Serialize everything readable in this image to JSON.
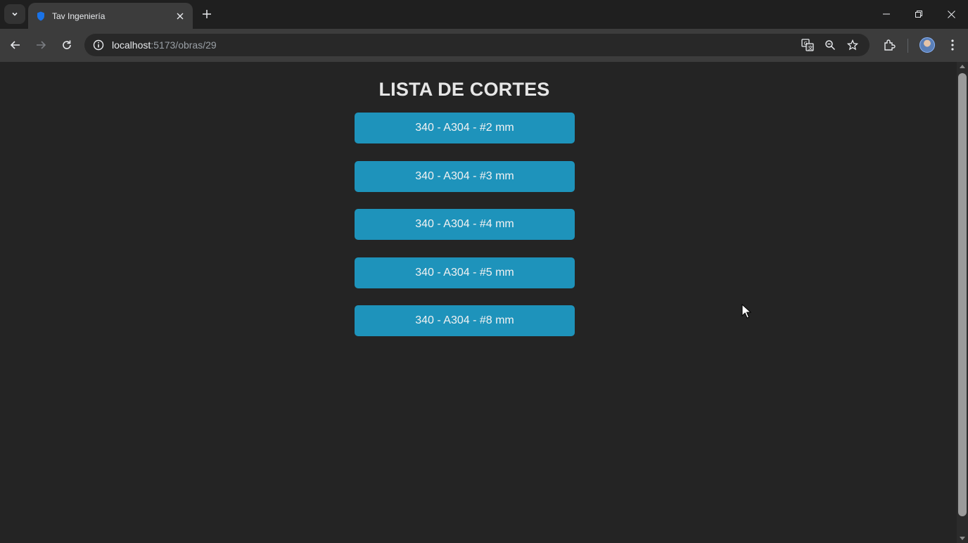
{
  "browser": {
    "tab_title": "Tav Ingeniería",
    "url_host": "localhost",
    "url_path": ":5173/obras/29",
    "accent_favicon": "#1a73e8"
  },
  "page": {
    "title": "LISTA DE CORTES",
    "button_color": "#1e93bb",
    "cuts": [
      {
        "label": "340 - A304 - #2 mm"
      },
      {
        "label": "340 - A304 - #3 mm"
      },
      {
        "label": "340 - A304 - #4 mm"
      },
      {
        "label": "340 - A304 - #5 mm"
      },
      {
        "label": "340 - A304 - #8 mm"
      }
    ]
  }
}
